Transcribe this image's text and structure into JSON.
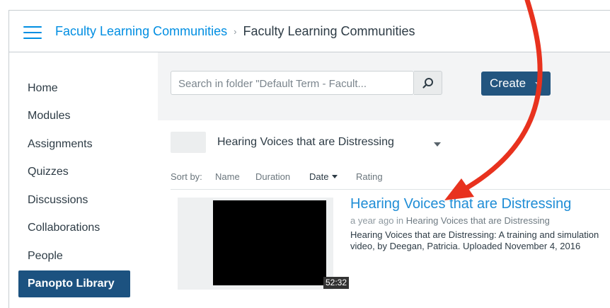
{
  "header": {
    "breadcrumb_link": "Faculty Learning Communities",
    "separator": "›",
    "breadcrumb_current": "Faculty Learning Communities"
  },
  "sidebar": {
    "items": [
      {
        "label": "Home"
      },
      {
        "label": "Modules"
      },
      {
        "label": "Assignments"
      },
      {
        "label": "Quizzes"
      },
      {
        "label": "Discussions"
      },
      {
        "label": "Collaborations"
      },
      {
        "label": "People"
      },
      {
        "label": "Panopto Library"
      }
    ]
  },
  "toolbar": {
    "search_placeholder": "Search in folder \"Default Term - Facult...",
    "create_label": "Create"
  },
  "folder": {
    "name": "Hearing Voices that are Distressing"
  },
  "sort": {
    "prefix": "Sort by:",
    "options": [
      "Name",
      "Duration",
      "Date",
      "Rating"
    ],
    "active": "Date"
  },
  "session": {
    "title": "Hearing Voices that are Distressing",
    "age": "a year ago in ",
    "folder": "Hearing Voices that are Distressing",
    "description_line1": "Hearing Voices that are Distressing: A training and simulation",
    "description_line2": "video, by Deegan, Patricia. Uploaded November 4, 2016",
    "duration": "52:32"
  },
  "colors": {
    "accent": "#008ee2",
    "nav_active": "#1c5280",
    "create_button": "#23557f",
    "annotation_arrow": "#e8321e"
  },
  "icons": {
    "menu": "hamburger-icon",
    "search": "magnifier-icon",
    "annotation": "red-arrow"
  }
}
